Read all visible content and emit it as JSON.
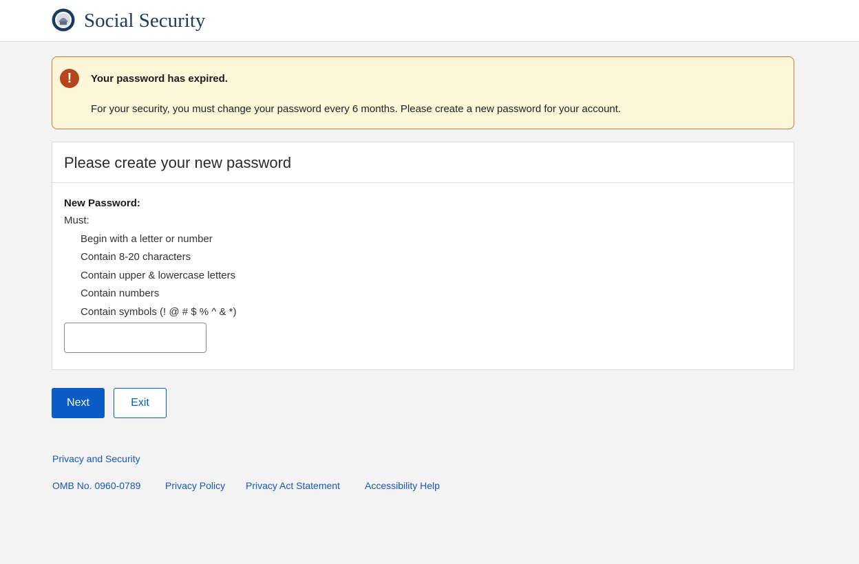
{
  "header": {
    "brand": "Social Security",
    "logo_icon": "ssa-seal-icon"
  },
  "alert": {
    "icon": "exclamation-icon",
    "icon_glyph": "!",
    "title": "Your password has expired.",
    "message": "For your security, you must change your password every 6 months. Please create a new password for your account."
  },
  "card": {
    "title": "Please create your new password",
    "field_label": "New Password:",
    "must_label": "Must:",
    "rules": [
      "Begin with a letter or number",
      "Contain 8-20 characters",
      "Contain upper & lowercase letters",
      "Contain numbers",
      "Contain symbols (! @ # $ % ^ & *)"
    ],
    "password_value": ""
  },
  "actions": {
    "next_label": "Next",
    "exit_label": "Exit"
  },
  "footer": {
    "privacy_security": "Privacy and Security",
    "omb": "OMB No. 0960-0789",
    "privacy_policy": "Privacy Policy",
    "privacy_act": "Privacy Act Statement",
    "accessibility": "Accessibility Help"
  },
  "colors": {
    "brand": "#1c3a5e",
    "alert_bg": "#fdf7d9",
    "alert_border": "#c87a3a",
    "alert_icon": "#b5461b",
    "primary": "#0b5cc4",
    "link": "#1a56b8"
  }
}
